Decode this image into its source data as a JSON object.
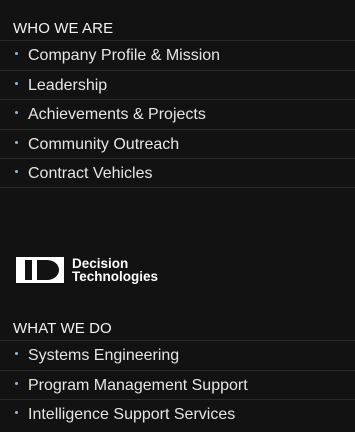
{
  "who_we_are": {
    "title": "WHO WE ARE",
    "items": [
      {
        "label": "Company Profile & Mission"
      },
      {
        "label": "Leadership"
      },
      {
        "label": "Achievements & Projects"
      },
      {
        "label": "Community Outreach"
      },
      {
        "label": "Contract Vehicles"
      }
    ]
  },
  "logo": {
    "line1": "Decision",
    "line2": "Technologies"
  },
  "what_we_do": {
    "title": "WHAT WE DO",
    "items": [
      {
        "label": "Systems Engineering"
      },
      {
        "label": "Program Management Support"
      },
      {
        "label": "Intelligence Support Services"
      }
    ]
  },
  "colors": {
    "background": "#121212",
    "text": "#e6e6e6",
    "bullet": "#8fb3d4",
    "divider": "#2b2b2b"
  }
}
